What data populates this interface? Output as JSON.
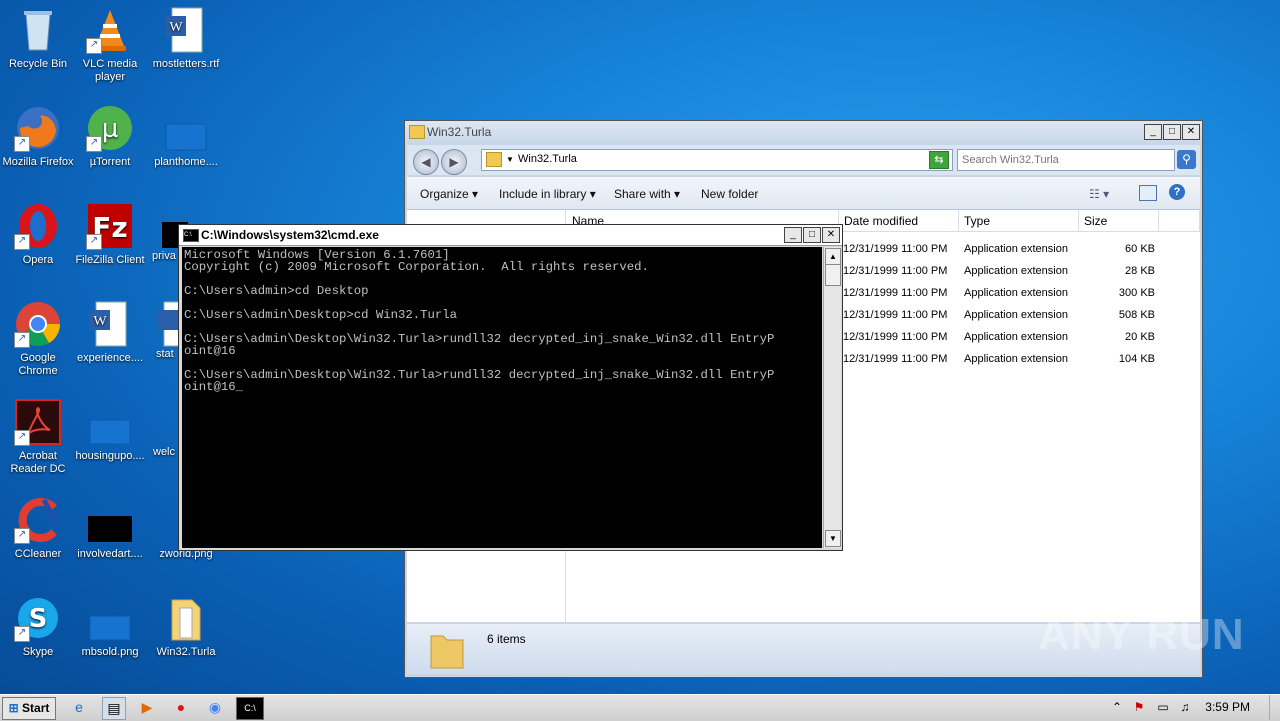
{
  "desktop": {
    "icons": [
      {
        "label": "Recycle Bin"
      },
      {
        "label": "VLC media player"
      },
      {
        "label": "mostletters.rtf"
      },
      {
        "label": "Mozilla Firefox"
      },
      {
        "label": "µTorrent"
      },
      {
        "label": "planthome...."
      },
      {
        "label": "Opera"
      },
      {
        "label": "FileZilla Client"
      },
      {
        "label": "priva"
      },
      {
        "label": "Google Chrome"
      },
      {
        "label": "experience...."
      },
      {
        "label": "stat"
      },
      {
        "label": "Acrobat Reader DC"
      },
      {
        "label": "housingupo...."
      },
      {
        "label": "welc"
      },
      {
        "label": "CCleaner"
      },
      {
        "label": "involvedart...."
      },
      {
        "label": "zworld.png"
      },
      {
        "label": "Skype"
      },
      {
        "label": "mbsold.png"
      },
      {
        "label": "Win32.Turla"
      }
    ]
  },
  "explorer": {
    "title": "Win32.Turla",
    "address": "Win32.Turla",
    "search_placeholder": "Search Win32.Turla",
    "toolbar": {
      "organize": "Organize",
      "include": "Include in library",
      "share": "Share with",
      "newfolder": "New folder"
    },
    "columns": {
      "name": "Name",
      "date": "Date modified",
      "type": "Type",
      "size": "Size"
    },
    "rows": [
      {
        "date": "12/31/1999 11:00 PM",
        "type": "Application extension",
        "size": "60 KB"
      },
      {
        "date": "12/31/1999 11:00 PM",
        "type": "Application extension",
        "size": "28 KB"
      },
      {
        "date": "12/31/1999 11:00 PM",
        "type": "Application extension",
        "size": "300 KB"
      },
      {
        "date": "12/31/1999 11:00 PM",
        "type": "Application extension",
        "size": "508 KB"
      },
      {
        "date": "12/31/1999 11:00 PM",
        "type": "Application extension",
        "size": "20 KB"
      },
      {
        "date": "12/31/1999 11:00 PM",
        "type": "Application extension",
        "size": "104 KB"
      }
    ],
    "status": "6 items"
  },
  "cmd": {
    "title": "C:\\Windows\\system32\\cmd.exe",
    "lines": [
      "Microsoft Windows [Version 6.1.7601]",
      "Copyright (c) 2009 Microsoft Corporation.  All rights reserved.",
      "",
      "C:\\Users\\admin>cd Desktop",
      "",
      "C:\\Users\\admin\\Desktop>cd Win32.Turla",
      "",
      "C:\\Users\\admin\\Desktop\\Win32.Turla>rundll32 decrypted_inj_snake_Win32.dll EntryP",
      "oint@16",
      "",
      "C:\\Users\\admin\\Desktop\\Win32.Turla>rundll32 decrypted_inj_snake_Win32.dll EntryP",
      "oint@16_"
    ]
  },
  "taskbar": {
    "start": "Start",
    "clock": "3:59 PM"
  },
  "watermark": "ANY RUN"
}
